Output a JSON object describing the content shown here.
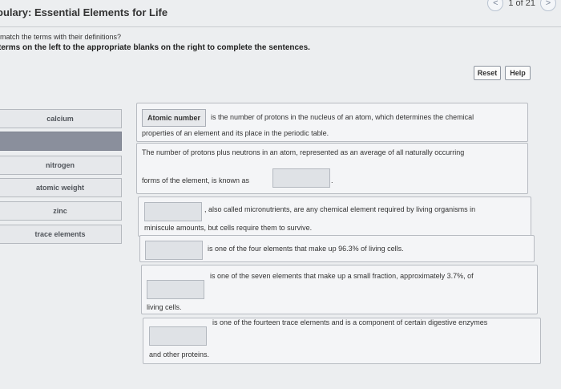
{
  "header": {
    "title": "oulary: Essential Elements for Life",
    "pager": {
      "text": "1 of 21",
      "prev": "<",
      "next": ">"
    }
  },
  "question": "match the terms with their definitions?",
  "instructions": "terms on the left to the appropriate blanks on the right to complete the sentences.",
  "buttons": {
    "reset": "Reset",
    "help": "Help"
  },
  "terms": [
    "calcium",
    "",
    "nitrogen",
    "atomic weight",
    "zinc",
    "trace elements"
  ],
  "sentences": [
    {
      "filled": "Atomic number",
      "line1": "is the number of protons in the nucleus of an atom, which determines the chemical",
      "line2": "properties of an element and its place in the periodic table."
    },
    {
      "line1": "The number of protons plus neutrons in an atom, represented as an average of all naturally occurring",
      "line2_before": "forms of the element, is known as",
      "line2_after": "."
    },
    {
      "line1": ", also called micronutrients, are any chemical element required by living organisms in",
      "line2": "miniscule amounts, but cells require them to survive."
    },
    {
      "line1": "is one of the four elements that make up 96.3% of living cells."
    },
    {
      "line1": "is one of the seven elements that make up a small fraction, approximately 3.7%, of",
      "line2": "living cells."
    },
    {
      "line1": "is one of the fourteen trace elements and is a component of certain digestive enzymes",
      "line2": "and other proteins."
    }
  ]
}
